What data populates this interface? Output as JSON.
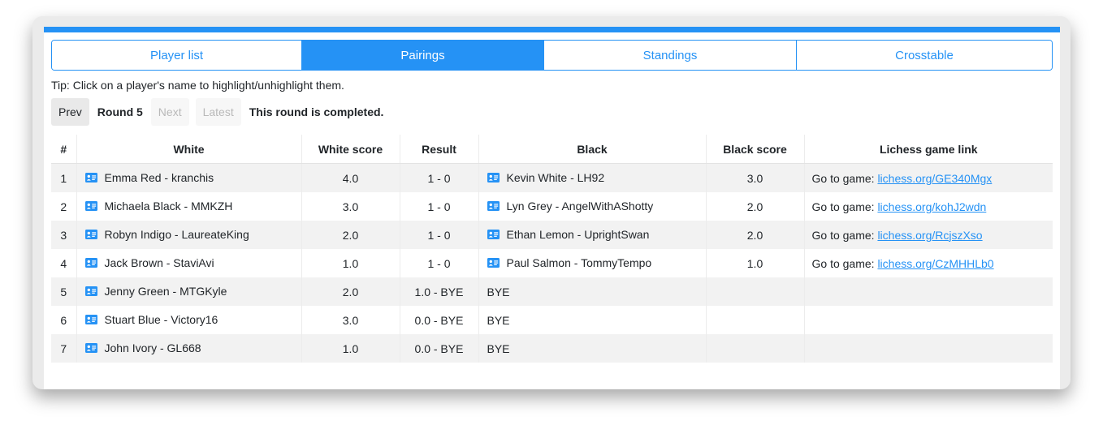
{
  "tabs": [
    {
      "label": "Player list",
      "active": false
    },
    {
      "label": "Pairings",
      "active": true
    },
    {
      "label": "Standings",
      "active": false
    },
    {
      "label": "Crosstable",
      "active": false
    }
  ],
  "tip": "Tip: Click on a player's name to highlight/unhighlight them.",
  "nav": {
    "prev_label": "Prev",
    "round_label": "Round 5",
    "next_label": "Next",
    "latest_label": "Latest",
    "status": "This round is completed."
  },
  "table": {
    "headers": [
      "#",
      "White",
      "White score",
      "Result",
      "Black",
      "Black score",
      "Lichess game link"
    ],
    "link_prefix": "Go to game: ",
    "rows": [
      {
        "num": "1",
        "white": "Emma Red - kranchis",
        "white_score": "4.0",
        "result": "1 - 0",
        "black": "Kevin White - LH92",
        "black_is_player": true,
        "black_score": "3.0",
        "link": "lichess.org/GE340Mgx"
      },
      {
        "num": "2",
        "white": "Michaela Black - MMKZH",
        "white_score": "3.0",
        "result": "1 - 0",
        "black": "Lyn Grey - AngelWithAShotty",
        "black_is_player": true,
        "black_score": "2.0",
        "link": "lichess.org/kohJ2wdn"
      },
      {
        "num": "3",
        "white": "Robyn Indigo - LaureateKing",
        "white_score": "2.0",
        "result": "1 - 0",
        "black": "Ethan Lemon - UprightSwan",
        "black_is_player": true,
        "black_score": "2.0",
        "link": "lichess.org/RcjszXso"
      },
      {
        "num": "4",
        "white": "Jack Brown - StaviAvi",
        "white_score": "1.0",
        "result": "1 - 0",
        "black": "Paul Salmon - TommyTempo",
        "black_is_player": true,
        "black_score": "1.0",
        "link": "lichess.org/CzMHHLb0"
      },
      {
        "num": "5",
        "white": "Jenny Green - MTGKyle",
        "white_score": "2.0",
        "result": "1.0 - BYE",
        "black": "BYE",
        "black_is_player": false,
        "black_score": "",
        "link": ""
      },
      {
        "num": "6",
        "white": "Stuart Blue - Victory16",
        "white_score": "3.0",
        "result": "0.0 - BYE",
        "black": "BYE",
        "black_is_player": false,
        "black_score": "",
        "link": ""
      },
      {
        "num": "7",
        "white": "John Ivory - GL668",
        "white_score": "1.0",
        "result": "0.0 - BYE",
        "black": "BYE",
        "black_is_player": false,
        "black_score": "",
        "link": ""
      }
    ]
  },
  "colors": {
    "accent": "#2592f5",
    "row_stripe": "#f2f2f2",
    "disabled_text": "#b9b9b9"
  },
  "icons": {
    "player": "id-card-icon"
  }
}
